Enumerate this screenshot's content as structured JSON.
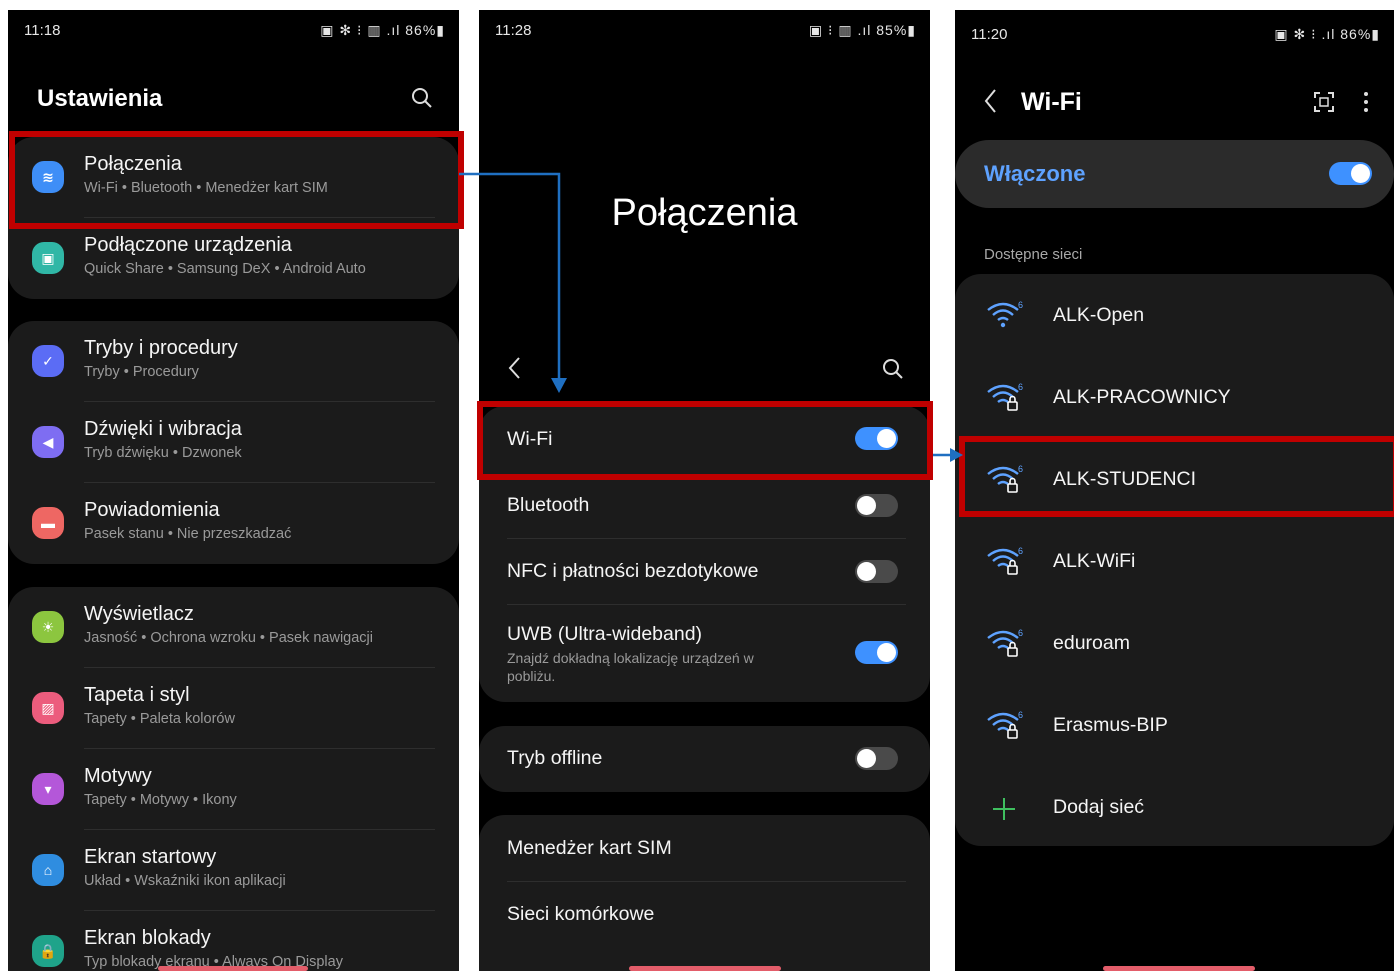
{
  "screen1": {
    "time": "11:18",
    "status": "▣ ✻ ⁝ ▥ .ıl 86%▮",
    "title": "Ustawienia",
    "items": [
      {
        "label": "Połączenia",
        "sub": "Wi-Fi  •  Bluetooth  •  Menedżer kart SIM",
        "color": "#3e8ef7",
        "glyph": "≋"
      },
      {
        "label": "Podłączone urządzenia",
        "sub": "Quick Share  •  Samsung DeX  •  Android Auto",
        "color": "#30b7a6",
        "glyph": "▣"
      },
      {
        "label": "Tryby i procedury",
        "sub": "Tryby  •  Procedury",
        "color": "#5b6cf5",
        "glyph": "✓"
      },
      {
        "label": "Dźwięki i wibracja",
        "sub": "Tryb dźwięku  •  Dzwonek",
        "color": "#7e6df2",
        "glyph": "◀"
      },
      {
        "label": "Powiadomienia",
        "sub": "Pasek stanu  •  Nie przeszkadzać",
        "color": "#ee6763",
        "glyph": "▬"
      },
      {
        "label": "Wyświetlacz",
        "sub": "Jasność  •  Ochrona wzroku  •  Pasek nawigacji",
        "color": "#8cc63f",
        "glyph": "☀"
      },
      {
        "label": "Tapeta i styl",
        "sub": "Tapety  •  Paleta kolorów",
        "color": "#ec5c7d",
        "glyph": "▨"
      },
      {
        "label": "Motywy",
        "sub": "Tapety  •  Motywy  •  Ikony",
        "color": "#b457d9",
        "glyph": "▾"
      },
      {
        "label": "Ekran startowy",
        "sub": "Układ  •  Wskaźniki ikon aplikacji",
        "color": "#2f8de0",
        "glyph": "⌂"
      },
      {
        "label": "Ekran blokady",
        "sub": "Typ blokady ekranu  •  Always On Display",
        "color": "#1fa38a",
        "glyph": "🔒"
      }
    ]
  },
  "screen2": {
    "time": "11:28",
    "status": "▣ ⁝ ▥ .ıl 85%▮",
    "title": "Połączenia",
    "items": [
      {
        "label": "Wi-Fi",
        "on": true
      },
      {
        "label": "Bluetooth",
        "on": false
      },
      {
        "label": "NFC i płatności bezdotykowe",
        "on": false
      },
      {
        "label": "UWB (Ultra-wideband)",
        "sub": "Znajdź dokładną lokalizację urządzeń w pobliżu.",
        "on": true
      },
      {
        "label": "Tryb offline",
        "on": false
      },
      {
        "label": "Menedżer kart SIM"
      },
      {
        "label": "Sieci komórkowe"
      }
    ]
  },
  "screen3": {
    "time": "11:20",
    "status": "▣ ✻ ⁝ .ıl 86%▮",
    "title": "Wi-Fi",
    "switch_label": "Włączone",
    "section": "Dostępne sieci",
    "networks": [
      "ALK-Open",
      "ALK-PRACOWNICY",
      "ALK-STUDENCI",
      "ALK-WiFi",
      "eduroam",
      "Erasmus-BIP"
    ],
    "add_label": "Dodaj sieć"
  },
  "colors": {
    "highlight": "#c00000",
    "arrow": "#1f6fc1",
    "toggle_on": "#3e91ff",
    "accent_text": "#5ea2ff"
  }
}
